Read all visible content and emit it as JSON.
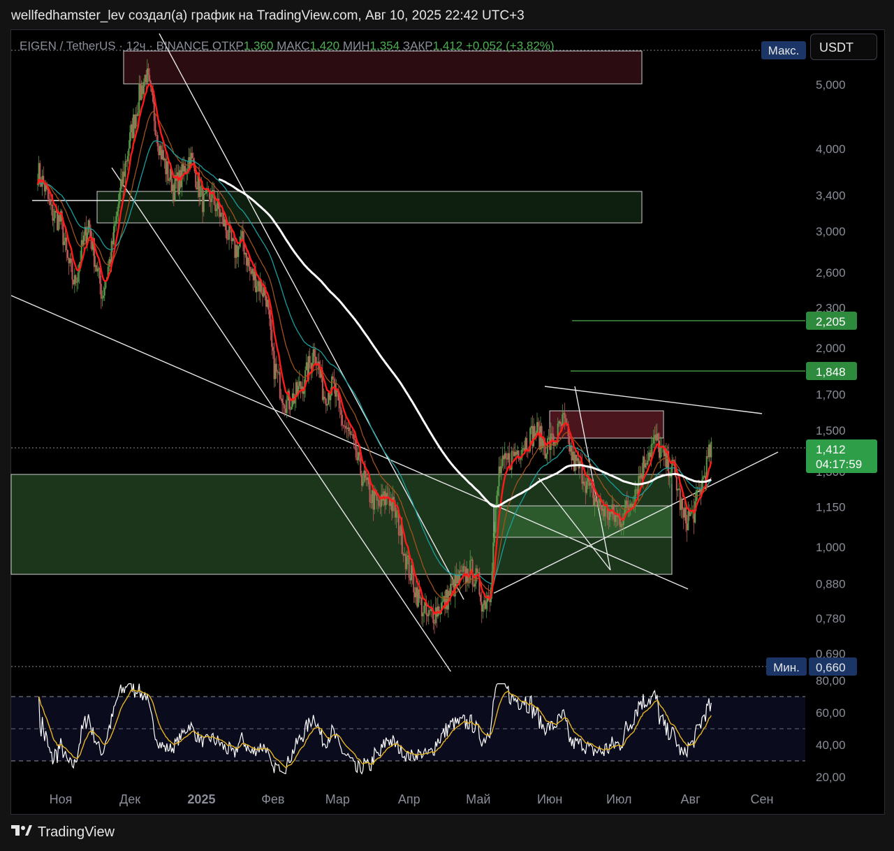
{
  "header": {
    "title": "wellfedhamster_lev создал(а) график на TradingView.com, Авг 10, 2025 22:42 UTC+3"
  },
  "legend": {
    "symbol": "EIGEN / TetherUS · 12ч · BINANCE",
    "open_label": "ОТКР",
    "open": "1,360",
    "high_label": "МАКС",
    "high": "1,420",
    "low_label": "МИН",
    "low": "1,354",
    "close_label": "ЗАКР",
    "close": "1,412",
    "change": "+0,052 (+3,82%)"
  },
  "currency_button": "USDT",
  "footer": {
    "logo_icon": "tradingview-logo-icon",
    "brand": "TradingView"
  },
  "colors": {
    "price_line": "#ff1a1a",
    "ema_orange": "#a0521c",
    "ema_teal": "#1a9e9e",
    "ma_white": "#ffffff",
    "rsi_line": "#ffffff",
    "rsi_signal": "#e6b422",
    "resistance_zone": "#3a1016",
    "support_zone": "#1e3d1e",
    "target_line": "#4caf50"
  },
  "chart_data": [
    {
      "type": "line",
      "title": "",
      "y_scale": "log",
      "ylim": [
        0.64,
        5.6
      ],
      "y_ticks": [
        "5,000",
        "4,000",
        "3,400",
        "3,000",
        "2,600",
        "2,300",
        "2,000",
        "1,700",
        "1,500",
        "1,300",
        "1,150",
        "1,000",
        "0,880",
        "0,780",
        "0,690"
      ],
      "x_ticks": [
        "Ноя",
        "Дек",
        "2025",
        "Фев",
        "Мар",
        "Апр",
        "Май",
        "Июн",
        "Июл",
        "Авг",
        "Сен"
      ],
      "series": [
        {
          "x": [
            "2024-10-22",
            "2024-10-25",
            "2024-10-28",
            "2024-11-01",
            "2024-11-04",
            "2024-11-07",
            "2024-11-10",
            "2024-11-13",
            "2024-11-16",
            "2024-11-19",
            "2024-11-23",
            "2024-11-26",
            "2024-11-29",
            "2024-12-02",
            "2024-12-05",
            "2024-12-08",
            "2024-12-11",
            "2024-12-14",
            "2024-12-17",
            "2024-12-20",
            "2024-12-23",
            "2024-12-27",
            "2024-12-30",
            "2025-01-02",
            "2025-01-05",
            "2025-01-09",
            "2025-01-12",
            "2025-01-15",
            "2025-01-19",
            "2025-01-22",
            "2025-01-26",
            "2025-01-29",
            "2025-02-01",
            "2025-02-04",
            "2025-02-07",
            "2025-02-11",
            "2025-02-15",
            "2025-02-19",
            "2025-02-23",
            "2025-02-27",
            "2025-03-03",
            "2025-03-07",
            "2025-03-11",
            "2025-03-15",
            "2025-03-19",
            "2025-03-23",
            "2025-03-27",
            "2025-03-31",
            "2025-04-03",
            "2025-04-06",
            "2025-04-09",
            "2025-04-12",
            "2025-04-16",
            "2025-04-20",
            "2025-04-24",
            "2025-04-28",
            "2025-05-01",
            "2025-05-03",
            "2025-05-06",
            "2025-05-10",
            "2025-05-14",
            "2025-05-18",
            "2025-05-22",
            "2025-05-26",
            "2025-05-30",
            "2025-06-03",
            "2025-06-07",
            "2025-06-11",
            "2025-06-15",
            "2025-06-19",
            "2025-06-23",
            "2025-06-27",
            "2025-07-01",
            "2025-07-05",
            "2025-07-09",
            "2025-07-13",
            "2025-07-17",
            "2025-07-21",
            "2025-07-25",
            "2025-07-29",
            "2025-08-02",
            "2025-08-06",
            "2025-08-10"
          ],
          "y": [
            3.7,
            3.5,
            3.2,
            3.1,
            2.7,
            2.5,
            2.8,
            3.1,
            2.7,
            2.4,
            2.8,
            3.3,
            3.8,
            4.3,
            4.8,
            5.2,
            4.6,
            4.0,
            3.7,
            3.5,
            3.6,
            3.9,
            3.6,
            3.3,
            3.4,
            3.2,
            3.0,
            2.8,
            2.9,
            2.6,
            2.5,
            2.4,
            1.9,
            1.75,
            1.65,
            1.7,
            1.8,
            2.0,
            1.7,
            1.75,
            1.55,
            1.45,
            1.3,
            1.2,
            1.15,
            1.2,
            1.1,
            0.95,
            0.88,
            0.82,
            0.78,
            0.8,
            0.82,
            0.87,
            0.9,
            0.92,
            0.88,
            0.82,
            0.86,
            1.3,
            1.35,
            1.4,
            1.45,
            1.5,
            1.42,
            1.45,
            1.55,
            1.35,
            1.3,
            1.2,
            1.15,
            1.12,
            1.1,
            1.15,
            1.25,
            1.38,
            1.45,
            1.35,
            1.3,
            1.1,
            1.12,
            1.25,
            1.412
          ]
        }
      ],
      "price_labels": {
        "max_label": "Макс.",
        "min_label": "Мин.",
        "min_value": "0,660",
        "target_1": "2,205",
        "target_2": "1,848",
        "current": "1,412",
        "countdown": "04:17:59"
      }
    },
    {
      "type": "line",
      "title": "",
      "ylim": [
        20,
        80
      ],
      "y_ticks": [
        "80,00",
        "60,00",
        "40,00",
        "20,00"
      ],
      "bands": [
        30,
        50,
        70
      ]
    }
  ]
}
